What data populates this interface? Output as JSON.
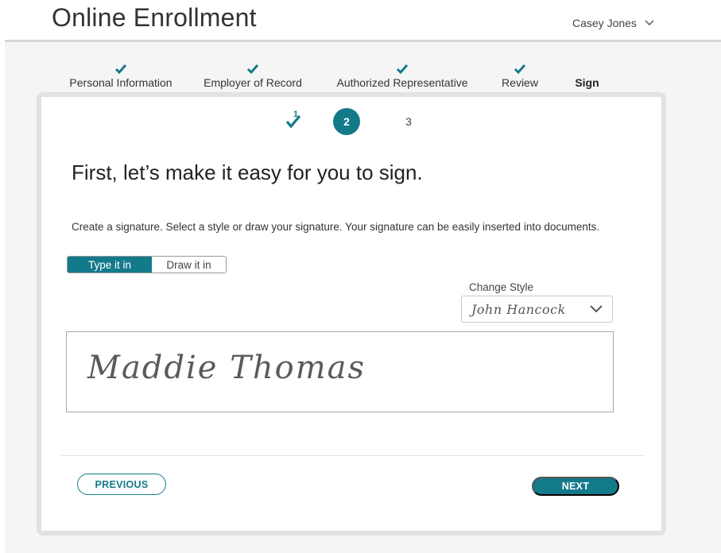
{
  "app": {
    "title": "Online Enrollment",
    "user_name": "Casey Jones",
    "user_menu_icon": "chevron-down-icon"
  },
  "steps": [
    {
      "label": "Personal Information",
      "completed": true,
      "active": false
    },
    {
      "label": "Employer of Record",
      "completed": true,
      "active": false
    },
    {
      "label": "Authorized Representative",
      "completed": true,
      "active": false
    },
    {
      "label": "Review",
      "completed": true,
      "active": false
    },
    {
      "label": "Sign",
      "completed": false,
      "active": true
    }
  ],
  "substeps": {
    "completed": "1",
    "current": "2",
    "upcoming": "3"
  },
  "main": {
    "heading": "First, let’s make it easy for you to sign.",
    "description": "Create a signature. Select a style or draw your signature. Your signature can be easily inserted into documents.",
    "toggle": {
      "type_label": "Type it in",
      "draw_label": "Draw it in",
      "selected": "Type it in"
    },
    "style": {
      "label": "Change Style",
      "selected": "John Hancock"
    },
    "signature": "Maddie Thomas"
  },
  "footer": {
    "previous_label": "PREVIOUS",
    "next_label": "NEXT"
  },
  "colors": {
    "accent": "#137a8a",
    "card_border": "#e4e1e1",
    "page_bg": "#f5f5f5"
  }
}
